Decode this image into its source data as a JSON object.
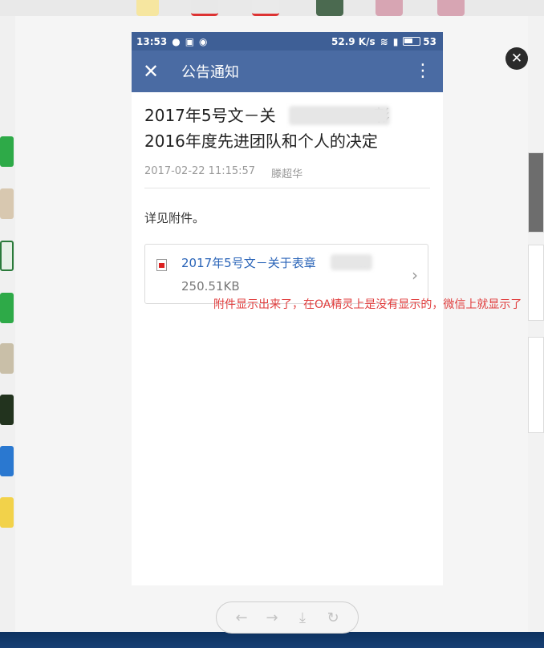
{
  "statusbar": {
    "time": "13:53",
    "net_speed": "52.9 K/s",
    "battery": "53",
    "icons": [
      "chat-bubble-icon",
      "image-icon",
      "wechat-icon",
      "wifi-icon",
      "signal-icon",
      "battery-icon"
    ]
  },
  "appbar": {
    "close_glyph": "✕",
    "title": "公告通知",
    "more_glyph": "⋮"
  },
  "article": {
    "title_line1": "2017年5号文－关",
    "title_line1_end": "彰",
    "title_line2": "2016年度先进团队和个人的决定",
    "date": "2017-02-22 11:15:57",
    "author": "滕超华",
    "body": "详见附件。"
  },
  "attachment": {
    "name": "2017年5号文－关于表章",
    "name_suffix": "..",
    "size": "250.51KB",
    "chevron": "›"
  },
  "annotation": "附件显示出来了，在OA精灵上是没有显示的，微信上就显示了",
  "viewer": {
    "close_glyph": "✕"
  },
  "nav": {
    "back": "←",
    "forward": "→",
    "download": "⤓",
    "rotate": "↻"
  },
  "colors": {
    "appbar": "#4a6ba3",
    "statusbar": "#3e5f96",
    "link": "#2a64b8",
    "annotation": "#e03c3c"
  }
}
